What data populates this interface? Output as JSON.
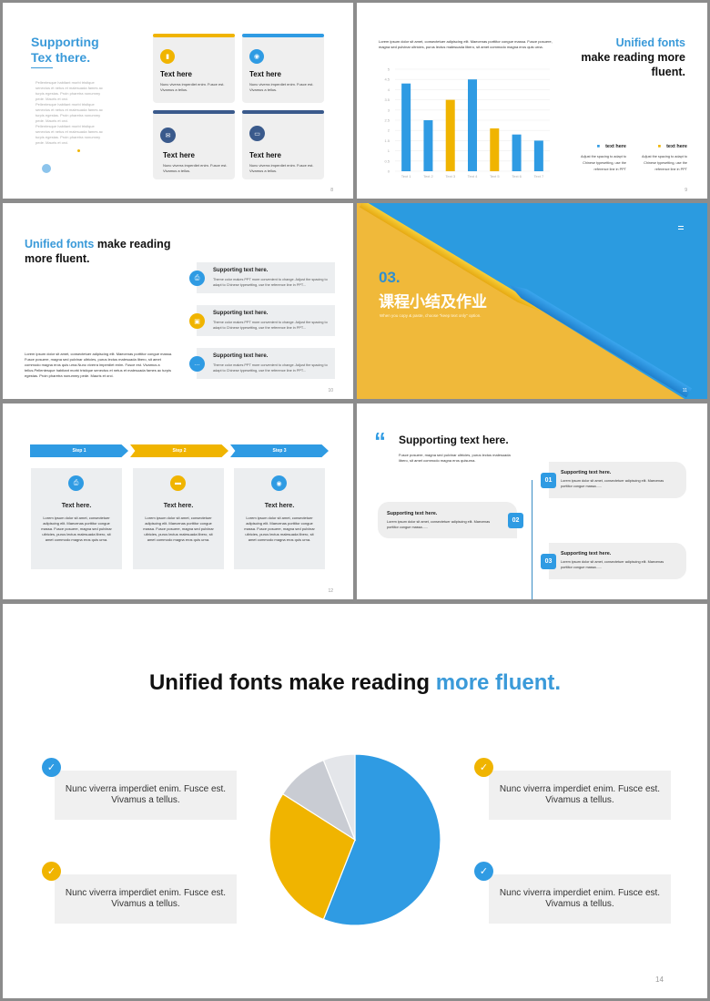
{
  "colors": {
    "blue": "#2f9be3",
    "yellow": "#f0b400",
    "navy": "#3a5a8c",
    "gray": "#c9ccd3",
    "light_gray": "#e4e6ea"
  },
  "slide8": {
    "title_line1": "Supporting",
    "title_line2": "Tex there.",
    "bullets": [
      "Pellentesque habitant morbi tristique senectus et netus et malesuada fames ac turpis egestas. Proin pharetra nonummy pede. Mauris et orci.",
      "Pellentesque habitant morbi tristique senectus et netus et malesuada fames ac turpis egestas. Proin pharetra nonummy pede. Mauris et orci.",
      "Pellentesque habitant morbi tristique senectus et netus et malesuada fames ac turpis egestas. Proin pharetra nonummy pede. Mauris et orci."
    ],
    "cards": [
      {
        "title": "Text here",
        "body": "Nunc viverra imperdiet enim. Fusce est. Vivamus a tellus.",
        "icon": "clipboard-icon"
      },
      {
        "title": "Text here",
        "body": "Nunc viverra imperdiet enim. Fusce est. Vivamus a tellus.",
        "icon": "location-icon"
      },
      {
        "title": "Text here",
        "body": "Nunc viverra imperdiet enim. Fusce est. Vivamus a tellus.",
        "icon": "mail-icon"
      },
      {
        "title": "Text here",
        "body": "Nunc viverra imperdiet enim. Fusce est. Vivamus a tellus.",
        "icon": "browser-icon"
      }
    ],
    "page": "8"
  },
  "slide9": {
    "intro": "Lorem ipsum dolor sit amet, consectetuer adipiscing elit. Maecenas porttitor congue massa. Fusce posuere, magna sed pulvinar ultricies, purus lectus malesuada libero, sit amet commodo magna eros quis urna.",
    "title_blue": "Unified fonts",
    "title_black": "make reading more fluent.",
    "legend": [
      {
        "label": "text here",
        "desc": "Adjust the spacing to adapt to Chinese typesetting, use the reference line in PPT"
      },
      {
        "label": "text here",
        "desc": "Adjust the spacing to adapt to Chinese typesetting, use the reference line in PPT"
      }
    ],
    "page": "9"
  },
  "chart_data": [
    {
      "type": "bar",
      "categories": [
        "Text 1",
        "Text 2",
        "Text 3",
        "Text 4",
        "Text 5",
        "Text 6",
        "Text 7"
      ],
      "values": [
        4.3,
        2.5,
        3.5,
        4.5,
        2.1,
        1.8,
        1.5
      ],
      "bar_colors": [
        "#2f9be3",
        "#2f9be3",
        "#f0b400",
        "#2f9be3",
        "#f0b400",
        "#2f9be3",
        "#2f9be3"
      ],
      "yticks": [
        "0",
        "0.5",
        "1",
        "1.5",
        "2",
        "2.5",
        "3",
        "3.5",
        "4",
        "4.5",
        "5"
      ],
      "ylim": [
        0,
        5
      ],
      "grid": true
    },
    {
      "type": "pie",
      "values": [
        56,
        28,
        10,
        6
      ],
      "colors": [
        "#2f9be3",
        "#f0b400",
        "#c9ccd3",
        "#e4e6ea"
      ]
    }
  ],
  "slide10": {
    "title_blue": "Unified fonts",
    "title_black": " make reading",
    "title_line2": "more fluent.",
    "body": "Lorem ipsum dolor sit amet, consectetuer adipiscing elit. Maecenas porttitor congue massa. Fusce posuere, magna sed pulvinar ultricies, purus lectus malesuada libero, sit amet commodo magna eros quis urna.Nunc viverra imperdiet enim. Fusce est. Vivamus a tellus.Pellentesque habitant morbi tristique senectus et netus et malesuada fames ac turpis egestas. Proin pharetra nonummy pede. Mauris et orci.",
    "items": [
      {
        "title": "Supporting text here.",
        "body": "Theme color makes PPT more convenient to change. Adjust the spacing to adapt to Chinese typesetting, use the reference line in PPT...",
        "icon": "printer-icon"
      },
      {
        "title": "Supporting text here.",
        "body": "Theme color makes PPT more convenient to change. Adjust the spacing to adapt to Chinese typesetting, use the reference line in PPT...",
        "icon": "image-icon"
      },
      {
        "title": "Supporting text here.",
        "body": "Theme color makes PPT more convenient to change. Adjust the spacing to adapt to Chinese typesetting, use the reference line in PPT...",
        "icon": "chat-icon"
      }
    ],
    "page": "10"
  },
  "slide11": {
    "number": "03.",
    "title": "课程小结及作业",
    "subtitle": "When you copy & paste, choose \"keep text only\" option.",
    "page": "11"
  },
  "slide12": {
    "steps": [
      {
        "label": "Step 1",
        "title": "Text here.",
        "body": "Lorem ipsum dolor sit amet, consectetuer adipiscing elit. Maecenas porttitor congue massa. Fusce posuere, magna sed pulvinar ultricies, purus lectus malesuada libero, sit amet commodo magna eros quis urna.",
        "icon": "printer-icon"
      },
      {
        "label": "Step 2",
        "title": "Text here.",
        "body": "Lorem ipsum dolor sit amet, consectetuer adipiscing elit. Maecenas porttitor congue massa. Fusce posuere, magna sed pulvinar ultricies, purus lectus malesuada libero, sit amet commodo magna eros quis urna.",
        "icon": "keyboard-icon"
      },
      {
        "label": "Step 3",
        "title": "Text here.",
        "body": "Lorem ipsum dolor sit amet, consectetuer adipiscing elit. Maecenas porttitor congue massa. Fusce posuere, magna sed pulvinar ultricies, purus lectus malesuada libero, sit amet commodo magna eros quis urna.",
        "icon": "target-icon"
      }
    ],
    "page": "12"
  },
  "slide13": {
    "quote": "“",
    "title": "Supporting text here.",
    "subtitle": "Fusce posuere, magna sed pulvinar ultricies, purus lectus malesuada libero, sit amet commodo magna eros quisurna.",
    "items": [
      {
        "num": "01",
        "title": "Supporting text here.",
        "body": "Lorem ipsum dolor sit amet, consectetuer adipiscing elit. Maecenas porttitor congue massa......"
      },
      {
        "num": "02",
        "title": "Supporting text here.",
        "body": "Lorem ipsum dolor sit amet, consectetuer adipiscing elit. Maecenas porttitor congue massa......"
      },
      {
        "num": "03",
        "title": "Supporting text here.",
        "body": "Lorem ipsum dolor sit amet, consectetuer adipiscing elit. Maecenas porttitor congue massa......"
      }
    ]
  },
  "slide14": {
    "title_black": "Unified fonts make reading ",
    "title_blue": "more fluent.",
    "boxes": [
      {
        "line1": "Nunc viverra imperdiet enim. Fusce est.",
        "line2": "Vivamus a tellus."
      },
      {
        "line1": "Nunc viverra imperdiet enim. Fusce est.",
        "line2": "Vivamus a tellus."
      },
      {
        "line1": "Nunc viverra imperdiet enim. Fusce est.",
        "line2": "Vivamus a tellus."
      },
      {
        "line1": "Nunc viverra imperdiet enim. Fusce est.",
        "line2": "Vivamus a tellus."
      }
    ],
    "page": "14"
  }
}
